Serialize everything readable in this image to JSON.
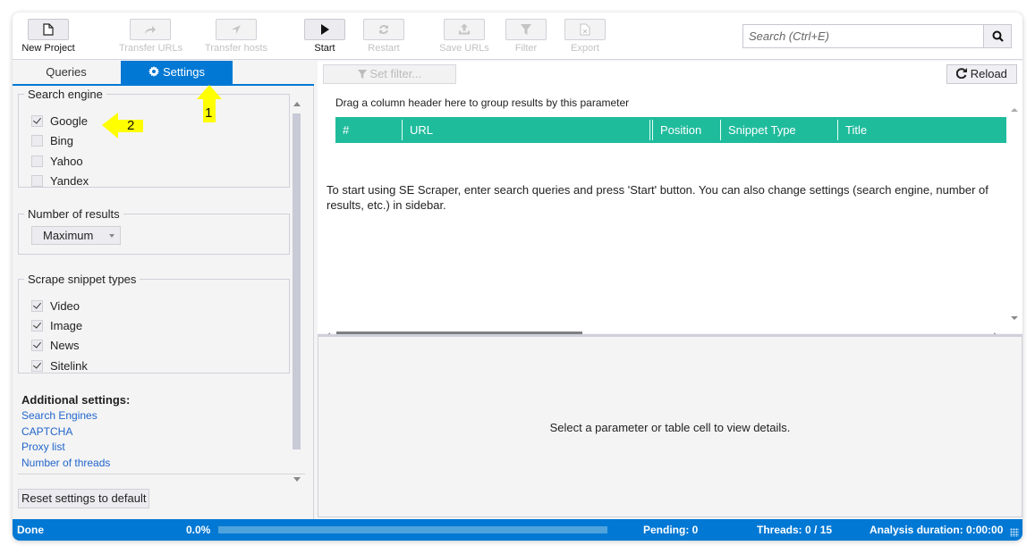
{
  "toolbar": {
    "buttons": [
      {
        "label": "New Project",
        "icon": "new-document-icon",
        "enabled": true
      },
      {
        "label": "Transfer URLs",
        "icon": "share-arrow-icon",
        "enabled": false
      },
      {
        "label": "Transfer hosts",
        "icon": "navigate-arrow-icon",
        "enabled": false
      },
      {
        "label": "Start",
        "icon": "play-icon",
        "enabled": true
      },
      {
        "label": "Restart",
        "icon": "refresh-icon",
        "enabled": false
      },
      {
        "label": "Save URLs",
        "icon": "upload-icon",
        "enabled": false
      },
      {
        "label": "Filter",
        "icon": "filter-icon",
        "enabled": false
      },
      {
        "label": "Export",
        "icon": "excel-file-icon",
        "enabled": false
      }
    ],
    "search": {
      "placeholder": "Search (Ctrl+E)",
      "value": "",
      "button_icon": "search-icon"
    }
  },
  "sidebar": {
    "tabs": [
      {
        "label": "Queries",
        "active": false
      },
      {
        "label": "Settings",
        "active": true,
        "icon": "gear-icon"
      }
    ],
    "search_engine": {
      "title": "Search engine",
      "options": [
        {
          "label": "Google",
          "checked": true
        },
        {
          "label": "Bing",
          "checked": false
        },
        {
          "label": "Yahoo",
          "checked": false
        },
        {
          "label": "Yandex",
          "checked": false
        }
      ]
    },
    "number_of_results": {
      "title": "Number of results",
      "selected": "Maximum"
    },
    "snippet_types": {
      "title": "Scrape snippet types",
      "options": [
        {
          "label": "Video",
          "checked": true
        },
        {
          "label": "Image",
          "checked": true
        },
        {
          "label": "News",
          "checked": true
        },
        {
          "label": "Sitelink",
          "checked": true
        }
      ]
    },
    "additional": {
      "heading": "Additional settings:",
      "links": [
        "Search Engines",
        "CAPTCHA",
        "Proxy list",
        "Number of threads"
      ]
    },
    "reset_label": "Reset settings to default"
  },
  "main": {
    "set_filter_label": "Set filter...",
    "reload_label": "Reload",
    "group_hint": "Drag a column header here to group results by this parameter",
    "columns": [
      "#",
      "URL",
      "Position",
      "Snippet Type",
      "Title"
    ],
    "empty_message": "To start using SE Scraper, enter search queries and press 'Start' button. You can also change settings (search engine, number of results, etc.) in sidebar.",
    "detail_message": "Select a parameter or table cell to view details."
  },
  "statusbar": {
    "status": "Done",
    "progress_text": "0.0%",
    "progress_fraction": 0.0,
    "pending": "Pending: 0",
    "threads": "Threads: 0 / 15",
    "duration": "Analysis duration: 0:00:00"
  },
  "annotations": [
    {
      "label": "1",
      "color": "#ffff00"
    },
    {
      "label": "2",
      "color": "#ffff00"
    }
  ],
  "colors": {
    "accent": "#0078d4",
    "grid_header": "#1fbc9c",
    "link": "#2266cc"
  }
}
